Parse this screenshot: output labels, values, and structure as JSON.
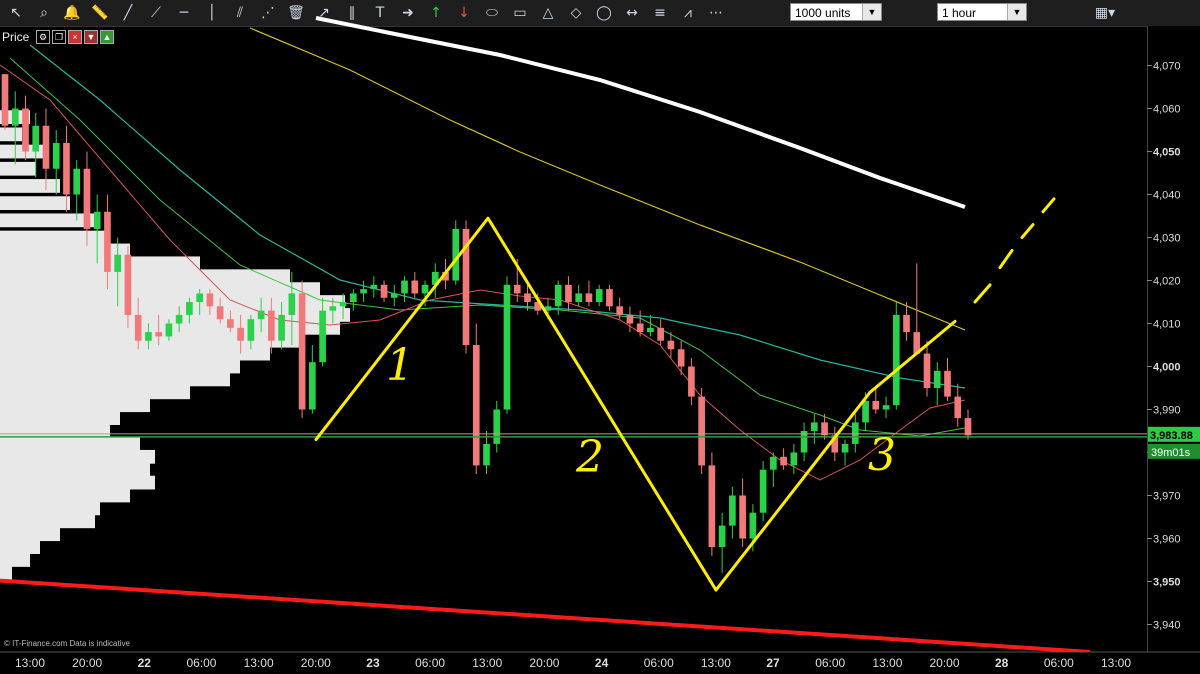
{
  "toolbar": {
    "units_select": "1000 units",
    "timeframe_select": "1 hour",
    "icons": [
      "cursor-icon",
      "zoom-icon",
      "alert-bell-icon",
      "ruler-icon",
      "line-icon",
      "ray-icon",
      "horizontal-line-icon",
      "vertical-line-icon",
      "channel-icon",
      "fan-icon",
      "delete-icon",
      "arrow-line-icon",
      "parallel-lines-icon",
      "text-tool-icon",
      "arrow-right-icon",
      "arrow-up-icon",
      "arrow-down-icon",
      "ellipse-icon",
      "rectangle-icon",
      "triangle-icon",
      "polygon-icon",
      "circle-icon",
      "measure-icon",
      "fibonacci-icon",
      "retracement-icon",
      "fib-fan-icon"
    ]
  },
  "price_label": "Price",
  "footer_text": "© IT-Finance.com  Data is indicative",
  "colors": {
    "bull": "#2bd14a",
    "bear": "#f07a7a",
    "ma_white": "#ffffff",
    "ma_yellow": "#d4c12a",
    "ma_teal": "#26b3a0",
    "ma_green": "#3fc23f",
    "ma_red": "#d9534f",
    "support_line": "#2e9e3e",
    "trend_line": "#ff1a1a",
    "annotation": "#ffee00",
    "price_box": "#2ecc40",
    "timer_box": "#1e8f2e"
  },
  "chart_data": {
    "type": "candlestick",
    "y_ticks": [
      3940,
      3950,
      3960,
      3970,
      3980,
      3990,
      4000,
      4010,
      4020,
      4030,
      4040,
      4050,
      4060,
      4070
    ],
    "y_tick_labels": [
      "3,940",
      "3,950",
      "3,960",
      "3,970",
      "3,980",
      "3,990",
      "4,000",
      "4,010",
      "4,020",
      "4,030",
      "4,040",
      "4,050",
      "4,060",
      "4,070"
    ],
    "ylim": [
      3933.6,
      4079.2
    ],
    "x_labels": [
      "13:00",
      "20:00",
      "22",
      "06:00",
      "13:00",
      "20:00",
      "23",
      "06:00",
      "13:00",
      "20:00",
      "24",
      "06:00",
      "13:00",
      "27",
      "06:00",
      "13:00",
      "20:00",
      "28",
      "06:00",
      "13:00"
    ],
    "x_label_bold": [
      false,
      false,
      true,
      false,
      false,
      false,
      true,
      false,
      false,
      false,
      true,
      false,
      false,
      true,
      false,
      false,
      false,
      true,
      false,
      false
    ],
    "current_price": 3983.88,
    "current_price_label": "3,983.88",
    "timer_label": "39m01s",
    "candles": [
      [
        4068,
        4068,
        4055,
        4056
      ],
      [
        4056,
        4064,
        4047,
        4060
      ],
      [
        4060,
        4063,
        4048,
        4050
      ],
      [
        4050,
        4059,
        4044,
        4056
      ],
      [
        4056,
        4060,
        4041,
        4046
      ],
      [
        4046,
        4055,
        4040,
        4052
      ],
      [
        4052,
        4056,
        4036,
        4040
      ],
      [
        4040,
        4048,
        4034,
        4046
      ],
      [
        4046,
        4050,
        4028,
        4032
      ],
      [
        4032,
        4040,
        4024,
        4036
      ],
      [
        4036,
        4040,
        4018,
        4022
      ],
      [
        4022,
        4030,
        4014,
        4026
      ],
      [
        4026,
        4028,
        4009,
        4012
      ],
      [
        4012,
        4016,
        4004,
        4006
      ],
      [
        4006,
        4010,
        4004,
        4008
      ],
      [
        4008,
        4012,
        4005,
        4007
      ],
      [
        4007,
        4011,
        4006,
        4010
      ],
      [
        4010,
        4014,
        4008,
        4012
      ],
      [
        4012,
        4016,
        4010,
        4015
      ],
      [
        4015,
        4018,
        4012,
        4017
      ],
      [
        4017,
        4018,
        4012,
        4014
      ],
      [
        4014,
        4016,
        4010,
        4011
      ],
      [
        4011,
        4013,
        4008,
        4009
      ],
      [
        4009,
        4012,
        4003,
        4006
      ],
      [
        4006,
        4012,
        4004,
        4011
      ],
      [
        4011,
        4016,
        4008,
        4013
      ],
      [
        4013,
        4016,
        4003,
        4006
      ],
      [
        4006,
        4015,
        4004,
        4012
      ],
      [
        4012,
        4022,
        4005,
        4017
      ],
      [
        4017,
        4020,
        3988,
        3990
      ],
      [
        3990,
        4005,
        3989,
        4001
      ],
      [
        4001,
        4016,
        4000,
        4013
      ],
      [
        4013,
        4016,
        4010,
        4014
      ],
      [
        4014,
        4017,
        4011,
        4015
      ],
      [
        4015,
        4018,
        4013,
        4017
      ],
      [
        4017,
        4020,
        4015,
        4018
      ],
      [
        4018,
        4021,
        4016,
        4019
      ],
      [
        4019,
        4020,
        4015,
        4016
      ],
      [
        4016,
        4019,
        4014,
        4017
      ],
      [
        4017,
        4021,
        4015,
        4020
      ],
      [
        4020,
        4022,
        4016,
        4017
      ],
      [
        4017,
        4020,
        4014,
        4019
      ],
      [
        4019,
        4024,
        4016,
        4022
      ],
      [
        4022,
        4025,
        4018,
        4020
      ],
      [
        4020,
        4034,
        4019,
        4032
      ],
      [
        4032,
        4034,
        4003,
        4005
      ],
      [
        4005,
        4010,
        3975,
        3977
      ],
      [
        3977,
        3985,
        3975,
        3982
      ],
      [
        3982,
        3992,
        3980,
        3990
      ],
      [
        3990,
        4021,
        3989,
        4019
      ],
      [
        4019,
        4025,
        4015,
        4017
      ],
      [
        4017,
        4019,
        4013,
        4015
      ],
      [
        4015,
        4017,
        4012,
        4013
      ],
      [
        4013,
        4016,
        4011,
        4014
      ],
      [
        4014,
        4020,
        4012,
        4019
      ],
      [
        4019,
        4021,
        4013,
        4015
      ],
      [
        4015,
        4019,
        4014,
        4017
      ],
      [
        4017,
        4020,
        4014,
        4015
      ],
      [
        4015,
        4019,
        4014,
        4018
      ],
      [
        4018,
        4019,
        4013,
        4014
      ],
      [
        4014,
        4016,
        4011,
        4012
      ],
      [
        4012,
        4014,
        4008,
        4010
      ],
      [
        4010,
        4013,
        4007,
        4008
      ],
      [
        4008,
        4012,
        4007,
        4009
      ],
      [
        4009,
        4011,
        4005,
        4006
      ],
      [
        4006,
        4008,
        4002,
        4004
      ],
      [
        4004,
        4006,
        3998,
        4000
      ],
      [
        4000,
        4002,
        3991,
        3993
      ],
      [
        3993,
        3995,
        3975,
        3977
      ],
      [
        3977,
        3980,
        3956,
        3958
      ],
      [
        3958,
        3966,
        3952,
        3963
      ],
      [
        3963,
        3972,
        3960,
        3970
      ],
      [
        3970,
        3974,
        3958,
        3960
      ],
      [
        3960,
        3968,
        3957,
        3966
      ],
      [
        3966,
        3978,
        3964,
        3976
      ],
      [
        3976,
        3980,
        3972,
        3979
      ],
      [
        3979,
        3981,
        3976,
        3977
      ],
      [
        3977,
        3982,
        3975,
        3980
      ],
      [
        3980,
        3987,
        3978,
        3985
      ],
      [
        3985,
        3989,
        3982,
        3987
      ],
      [
        3987,
        3989,
        3983,
        3984
      ],
      [
        3984,
        3986,
        3978,
        3980
      ],
      [
        3980,
        3983,
        3977,
        3982
      ],
      [
        3982,
        3989,
        3980,
        3987
      ],
      [
        3987,
        3994,
        3985,
        3992
      ],
      [
        3992,
        3995,
        3989,
        3990
      ],
      [
        3990,
        3993,
        3988,
        3991
      ],
      [
        3991,
        4015,
        3990,
        4012
      ],
      [
        4012,
        4015,
        4006,
        4008
      ],
      [
        4008,
        4024,
        4005,
        4003
      ],
      [
        4003,
        4006,
        3993,
        3995
      ],
      [
        3995,
        4001,
        3991,
        3999
      ],
      [
        3999,
        4002,
        3992,
        3993
      ],
      [
        3993,
        3996,
        3986,
        3988
      ],
      [
        3988,
        3990,
        3983,
        3984
      ]
    ],
    "moving_averages": [
      {
        "values": [
          [
            316,
            18
          ],
          [
            400,
            35
          ],
          [
            500,
            55
          ],
          [
            600,
            80
          ],
          [
            700,
            112
          ],
          [
            800,
            148
          ],
          [
            880,
            178
          ],
          [
            965,
            207
          ]
        ]
      },
      {
        "values": [
          [
            250,
            28
          ],
          [
            350,
            70
          ],
          [
            450,
            120
          ],
          [
            520,
            152
          ],
          [
            600,
            185
          ],
          [
            700,
            225
          ],
          [
            800,
            262
          ],
          [
            880,
            295
          ],
          [
            965,
            330
          ]
        ]
      },
      {
        "values": [
          [
            30,
            45
          ],
          [
            100,
            100
          ],
          [
            180,
            170
          ],
          [
            260,
            235
          ],
          [
            340,
            280
          ],
          [
            420,
            300
          ],
          [
            500,
            305
          ],
          [
            580,
            310
          ],
          [
            660,
            318
          ],
          [
            740,
            335
          ],
          [
            820,
            360
          ],
          [
            900,
            378
          ],
          [
            965,
            388
          ]
        ]
      },
      {
        "values": [
          [
            10,
            58
          ],
          [
            80,
            120
          ],
          [
            160,
            200
          ],
          [
            240,
            265
          ],
          [
            320,
            300
          ],
          [
            400,
            310
          ],
          [
            480,
            305
          ],
          [
            560,
            310
          ],
          [
            640,
            318
          ],
          [
            700,
            350
          ],
          [
            760,
            395
          ],
          [
            820,
            415
          ],
          [
            860,
            430
          ],
          [
            920,
            436
          ],
          [
            965,
            428
          ]
        ]
      },
      {
        "values": [
          [
            0,
            65
          ],
          [
            50,
            100
          ],
          [
            110,
            170
          ],
          [
            170,
            240
          ],
          [
            230,
            300
          ],
          [
            280,
            320
          ],
          [
            330,
            325
          ],
          [
            380,
            320
          ],
          [
            430,
            300
          ],
          [
            480,
            290
          ],
          [
            520,
            296
          ],
          [
            560,
            300
          ],
          [
            620,
            320
          ],
          [
            660,
            345
          ],
          [
            700,
            395
          ],
          [
            740,
            430
          ],
          [
            780,
            460
          ],
          [
            820,
            480
          ],
          [
            860,
            460
          ],
          [
            900,
            430
          ],
          [
            930,
            408
          ],
          [
            965,
            400
          ]
        ]
      }
    ],
    "annotations": [
      "1",
      "2",
      "3"
    ]
  }
}
